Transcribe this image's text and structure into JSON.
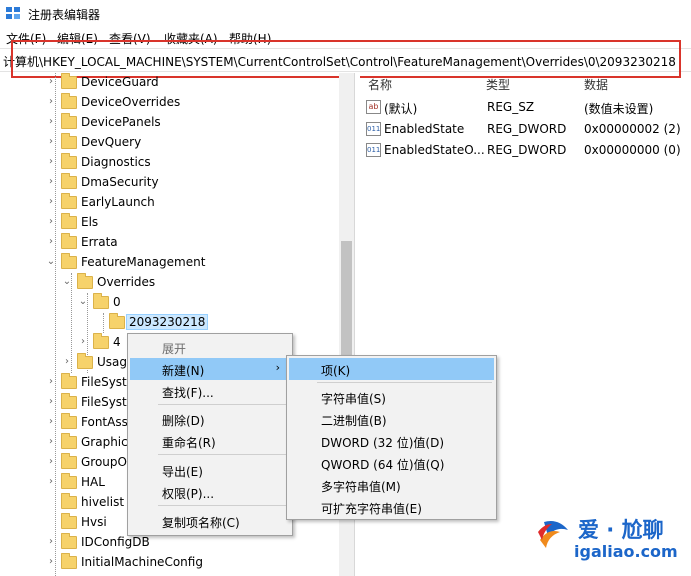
{
  "window": {
    "title": "注册表编辑器",
    "icon": "regedit-icon"
  },
  "menu": [
    "文件(F)",
    "编辑(E)",
    "查看(V)",
    "收藏夹(A)",
    "帮助(H)"
  ],
  "address": "计算机\\HKEY_LOCAL_MACHINE\\SYSTEM\\CurrentControlSet\\Control\\FeatureManagement\\Overrides\\0\\2093230218",
  "tree": {
    "items": [
      {
        "label": "DeviceGuard",
        "expander": "›"
      },
      {
        "label": "DeviceOverrides",
        "expander": "›"
      },
      {
        "label": "DevicePanels",
        "expander": "›"
      },
      {
        "label": "DevQuery",
        "expander": "›"
      },
      {
        "label": "Diagnostics",
        "expander": "›"
      },
      {
        "label": "DmaSecurity",
        "expander": "›"
      },
      {
        "label": "EarlyLaunch",
        "expander": "›"
      },
      {
        "label": "Els",
        "expander": "›"
      },
      {
        "label": "Errata",
        "expander": "›"
      },
      {
        "label": "FeatureManagement",
        "expander": "⌄"
      },
      {
        "label": "Overrides",
        "expander": "⌄"
      },
      {
        "label": "0",
        "expander": "⌄"
      },
      {
        "label": "2093230218",
        "expander": ""
      },
      {
        "label": "4",
        "expander": "›"
      },
      {
        "label": "Usag",
        "expander": "›"
      },
      {
        "label": "FileSyste",
        "expander": "›"
      },
      {
        "label": "FileSyste",
        "expander": "›"
      },
      {
        "label": "FontAss",
        "expander": "›"
      },
      {
        "label": "Graphic",
        "expander": "›"
      },
      {
        "label": "GroupO",
        "expander": "›"
      },
      {
        "label": "HAL",
        "expander": "›"
      },
      {
        "label": "hivelist",
        "expander": ""
      },
      {
        "label": "Hvsi",
        "expander": ""
      },
      {
        "label": "IDConfigDB",
        "expander": "›"
      },
      {
        "label": "InitialMachineConfig",
        "expander": "›"
      }
    ]
  },
  "values_pane": {
    "headers": {
      "name": "名称",
      "type": "类型",
      "data": "数据"
    },
    "rows": [
      {
        "icon": "ab",
        "name": "(默认)",
        "type": "REG_SZ",
        "data": "(数值未设置)"
      },
      {
        "icon": "011",
        "name": "EnabledState",
        "type": "REG_DWORD",
        "data": "0x00000002 (2)"
      },
      {
        "icon": "011",
        "name": "EnabledStateO...",
        "type": "REG_DWORD",
        "data": "0x00000000 (0)"
      }
    ]
  },
  "context_menu": {
    "items": [
      "展开",
      "新建(N)",
      "查找(F)...",
      "删除(D)",
      "重命名(R)",
      "导出(E)",
      "权限(P)...",
      "复制项名称(C)"
    ],
    "submenu_arrow": "›"
  },
  "submenu": {
    "items": [
      "项(K)",
      "字符串值(S)",
      "二进制值(B)",
      "DWORD (32 位)值(D)",
      "QWORD (64 位)值(Q)",
      "多字符串值(M)",
      "可扩充字符串值(E)"
    ]
  },
  "watermark": {
    "title": "爱 · 尬聊",
    "url": "igaliao.com"
  },
  "colors": {
    "highlight_box": "#d9342b",
    "selection": "#cce8ff",
    "menu_hover": "#91c9f7",
    "watermark": "#1c66c9"
  }
}
